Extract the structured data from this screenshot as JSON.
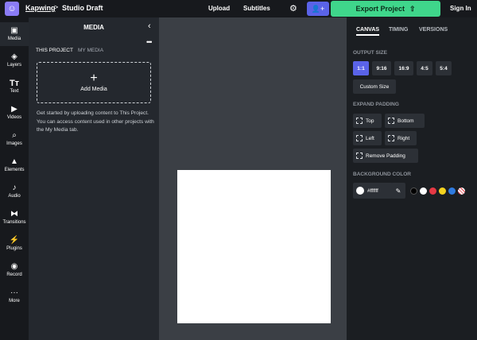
{
  "header": {
    "brand": "Kapwing",
    "separator": ">",
    "project_name": "Studio Draft",
    "upload_label": "Upload",
    "subtitles_label": "Subtitles",
    "settings_icon": "gear-icon",
    "invite_icon": "add-user-icon",
    "export_label": "Export Project",
    "export_icon": "share-icon",
    "signin_label": "Sign In"
  },
  "sidebar": {
    "items": [
      {
        "label": "Media",
        "icon": "media-icon"
      },
      {
        "label": "Layers",
        "icon": "layers-icon"
      },
      {
        "label": "Text",
        "icon": "text-icon"
      },
      {
        "label": "Videos",
        "icon": "video-icon"
      },
      {
        "label": "Images",
        "icon": "search-icon"
      },
      {
        "label": "Elements",
        "icon": "shapes-icon"
      },
      {
        "label": "Audio",
        "icon": "music-icon"
      },
      {
        "label": "Transitions",
        "icon": "transition-icon"
      },
      {
        "label": "Plugins",
        "icon": "plugin-icon"
      },
      {
        "label": "Record",
        "icon": "record-icon"
      },
      {
        "label": "More",
        "icon": "more-icon"
      }
    ]
  },
  "media_panel": {
    "title": "MEDIA",
    "tab_this": "THIS PROJECT",
    "tab_my": "MY MEDIA",
    "add_label": "Add Media",
    "hint": "Get started by uploading content to This Project. You can access content used in other projects with the My Media tab."
  },
  "right_panel": {
    "tabs": [
      "CANVAS",
      "TIMING",
      "VERSIONS"
    ],
    "output_size_label": "OUTPUT SIZE",
    "sizes": [
      "1:1",
      "9:16",
      "16:9",
      "4:5",
      "5:4"
    ],
    "custom_size_label": "Custom Size",
    "expand_padding_label": "EXPAND PADDING",
    "padding": {
      "top": "Top",
      "bottom": "Bottom",
      "left": "Left",
      "right": "Right",
      "remove": "Remove Padding"
    },
    "background_color_label": "BACKGROUND COLOR",
    "color_value": "#ffffff",
    "swatches": [
      "#000000",
      "#ffffff",
      "#e53945",
      "#f4d21f",
      "#2f7be0"
    ]
  },
  "colors": {
    "accent": "#5a63e8",
    "export": "#3fd68b"
  }
}
